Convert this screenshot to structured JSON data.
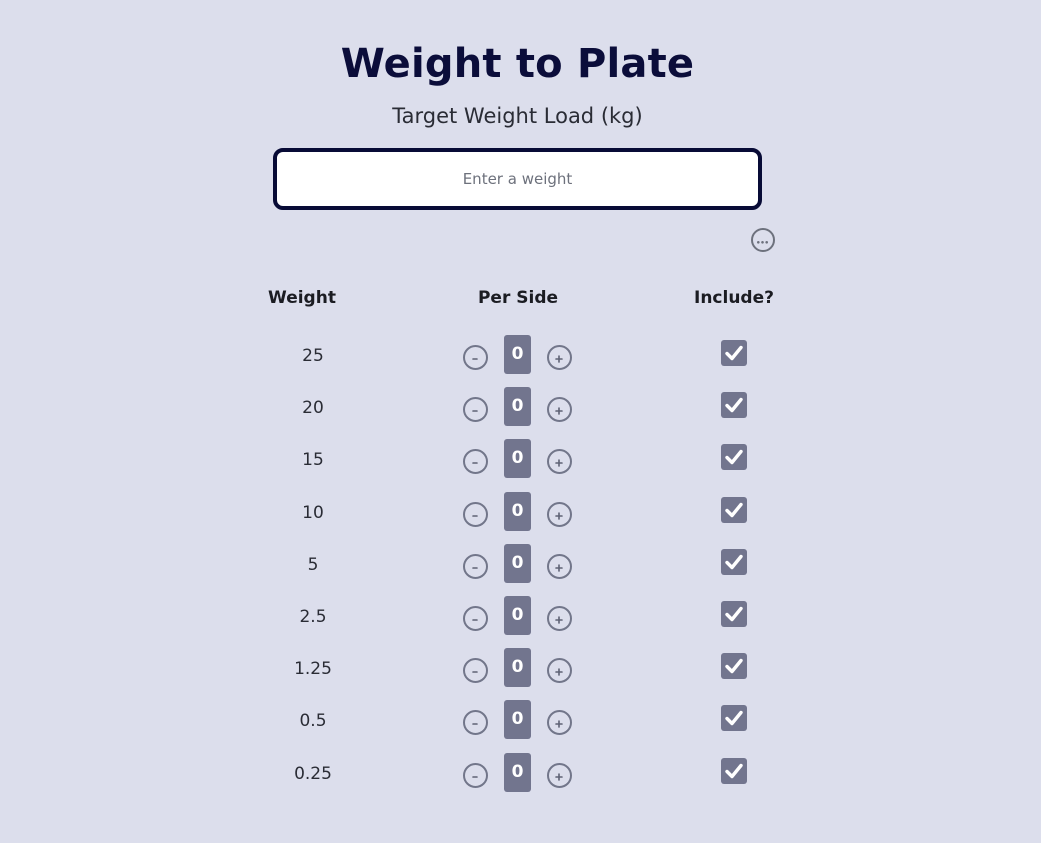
{
  "header": {
    "title": "Weight to Plate",
    "subtitle": "Target Weight Load (kg)"
  },
  "target_input": {
    "value": "",
    "placeholder": "Enter a weight"
  },
  "more_button_icon": "ellipsis-circle-icon",
  "table": {
    "columns": [
      "Weight",
      "Per Side",
      "Include?"
    ],
    "rows": [
      {
        "weight": "25",
        "per_side": "0",
        "include": true
      },
      {
        "weight": "20",
        "per_side": "0",
        "include": true
      },
      {
        "weight": "15",
        "per_side": "0",
        "include": true
      },
      {
        "weight": "10",
        "per_side": "0",
        "include": true
      },
      {
        "weight": "5",
        "per_side": "0",
        "include": true
      },
      {
        "weight": "2.5",
        "per_side": "0",
        "include": true
      },
      {
        "weight": "1.25",
        "per_side": "0",
        "include": true
      },
      {
        "weight": "0.5",
        "per_side": "0",
        "include": true
      },
      {
        "weight": "0.25",
        "per_side": "0",
        "include": true
      }
    ]
  },
  "colors": {
    "background": "#dcdeec",
    "title": "#0b0d3a",
    "input_border": "#080b36",
    "control_fill": "#72758e"
  }
}
